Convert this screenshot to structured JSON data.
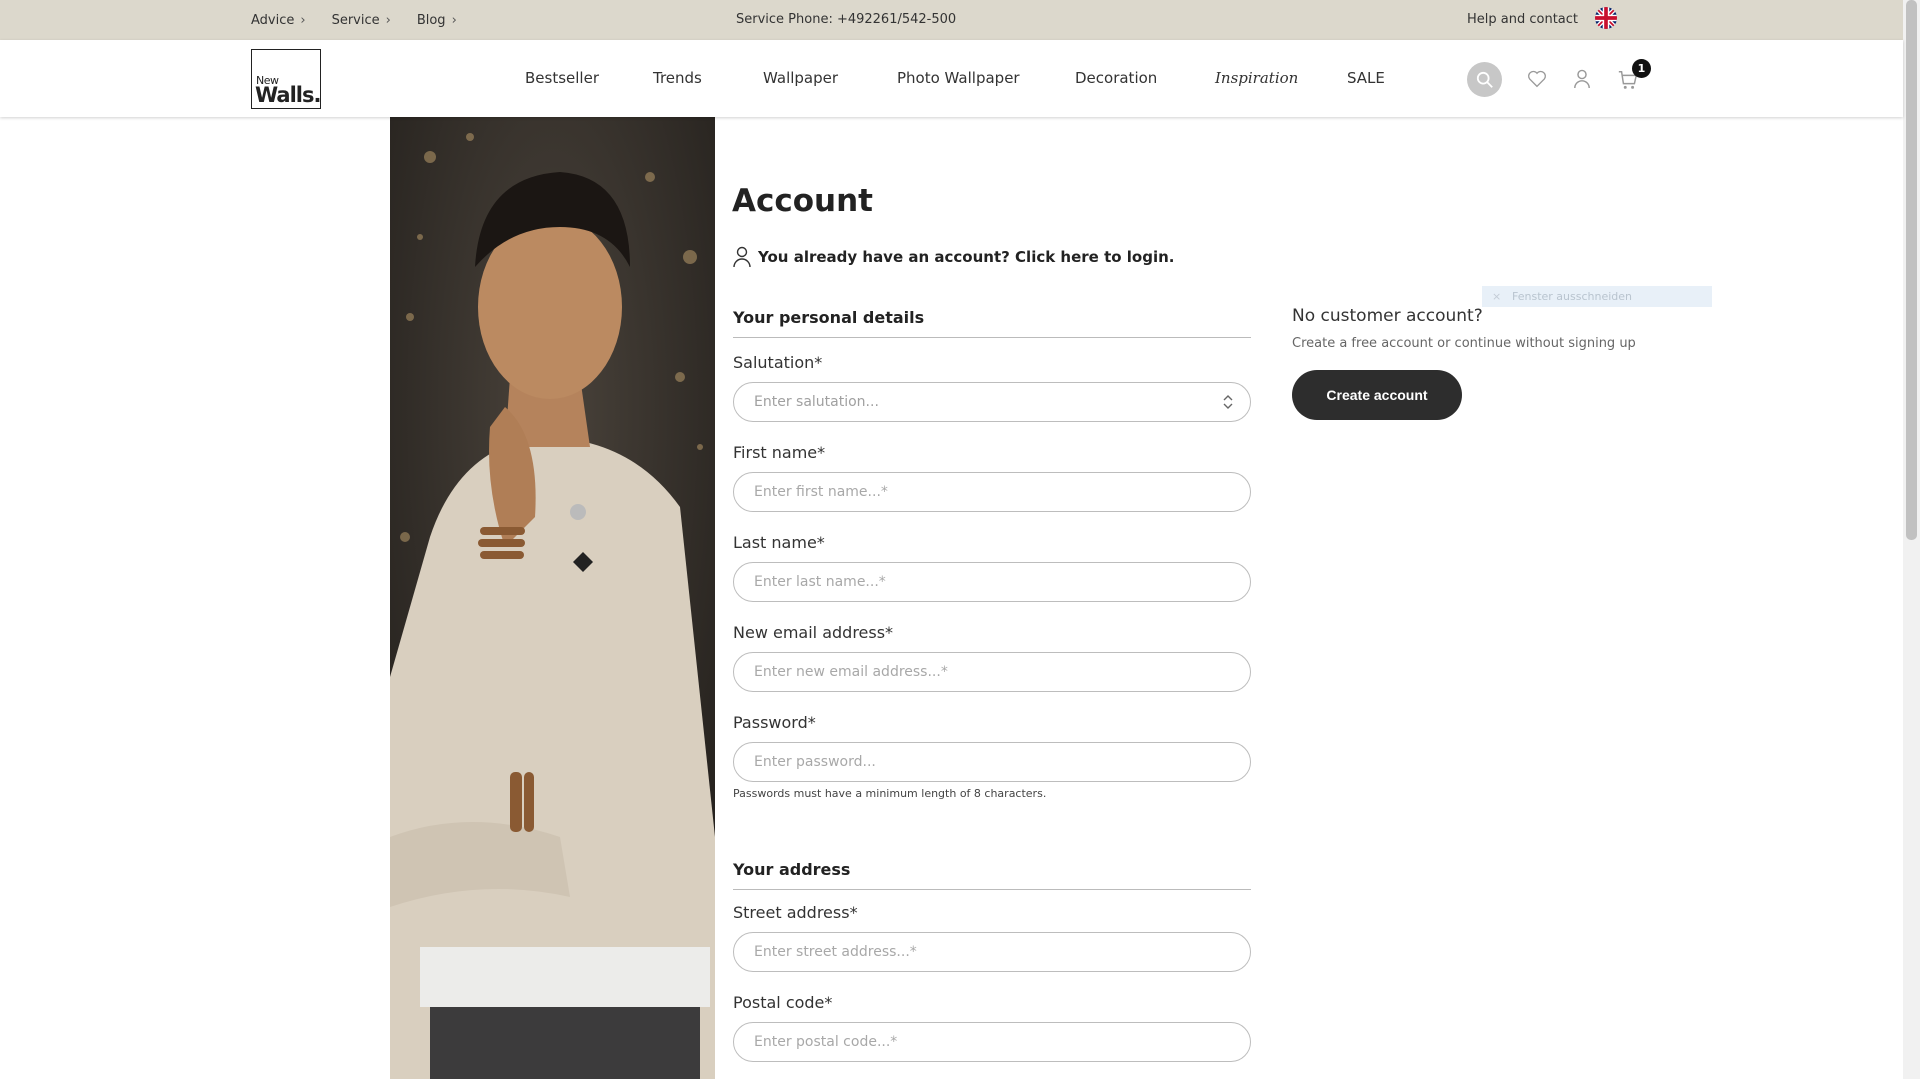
{
  "topbar": {
    "breadcrumbs": [
      "Advice",
      "Service",
      "Blog"
    ],
    "phone": "Service Phone: +492261/542-500",
    "help": "Help and contact",
    "language_icon": "uk-flag-icon"
  },
  "header": {
    "logo_top": "New",
    "logo_bottom": "Walls.",
    "nav": [
      "Bestseller",
      "Trends",
      "Wallpaper",
      "Photo Wallpaper",
      "Decoration",
      "Inspiration",
      "SALE"
    ],
    "cart_count": "1"
  },
  "main": {
    "title": "Account",
    "login_prompt": "You already have an account? Click here to login.",
    "personal_heading": "Your personal details",
    "fields": {
      "salutation": {
        "label": "Salutation*",
        "placeholder": "Enter salutation..."
      },
      "first_name": {
        "label": "First name*",
        "placeholder": "Enter first name...*"
      },
      "last_name": {
        "label": "Last name*",
        "placeholder": "Enter last name...*"
      },
      "email": {
        "label": "New email address*",
        "placeholder": "Enter new email address...*"
      },
      "password": {
        "label": "Password*",
        "placeholder": "Enter password..."
      },
      "street": {
        "label": "Street address*",
        "placeholder": "Enter street address...*"
      },
      "postal": {
        "label": "Postal code*",
        "placeholder": "Enter postal code...*"
      }
    },
    "password_hint": "Passwords must have a minimum length of 8 characters.",
    "address_heading": "Your address"
  },
  "sidebar": {
    "no_account_title": "No customer account?",
    "no_account_sub": "Create a free account or continue without signing up",
    "create_button": "Create account",
    "ghost_text": "Fenster ausschneiden"
  }
}
